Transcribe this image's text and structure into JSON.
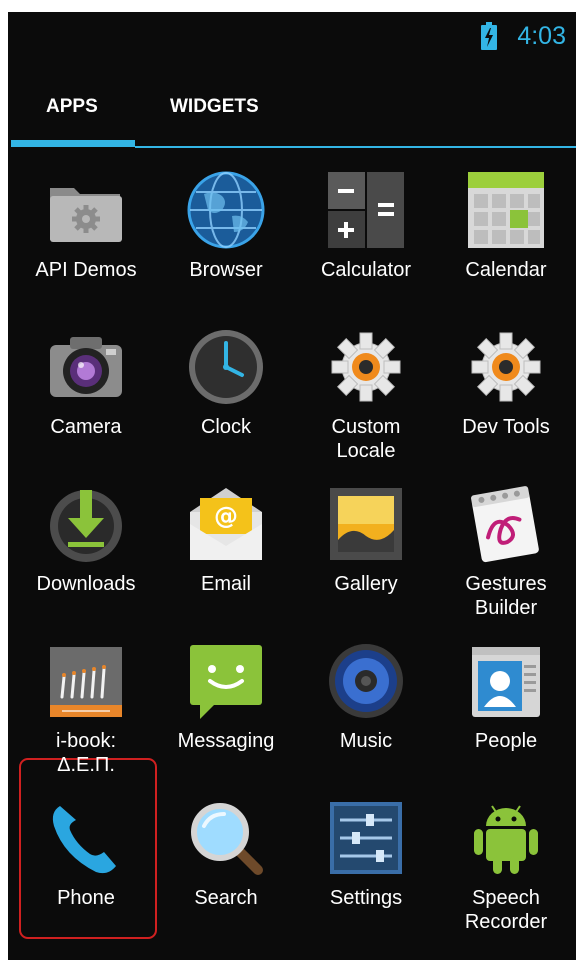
{
  "status_bar": {
    "time": "4:03",
    "battery_icon": "battery-charging-icon"
  },
  "tabs": [
    {
      "label": "APPS",
      "selected": true
    },
    {
      "label": "WIDGETS",
      "selected": false
    }
  ],
  "apps": [
    {
      "label": "API Demos",
      "icon": "folder-gear-icon"
    },
    {
      "label": "Browser",
      "icon": "globe-icon"
    },
    {
      "label": "Calculator",
      "icon": "calculator-icon"
    },
    {
      "label": "Calendar",
      "icon": "calendar-icon"
    },
    {
      "label": "Camera",
      "icon": "camera-icon"
    },
    {
      "label": "Clock",
      "icon": "clock-icon"
    },
    {
      "label": "Custom\nLocale",
      "icon": "gear-icon"
    },
    {
      "label": "Dev Tools",
      "icon": "gear-icon"
    },
    {
      "label": "Downloads",
      "icon": "download-icon"
    },
    {
      "label": "Email",
      "icon": "envelope-icon"
    },
    {
      "label": "Gallery",
      "icon": "picture-frame-icon"
    },
    {
      "label": "Gestures\nBuilder",
      "icon": "gesture-pad-icon"
    },
    {
      "label": "i-book:\nΔ.Ε.Π.",
      "icon": "ibook-icon",
      "highlighted": true
    },
    {
      "label": "Messaging",
      "icon": "speech-bubble-icon"
    },
    {
      "label": "Music",
      "icon": "speaker-icon"
    },
    {
      "label": "People",
      "icon": "contact-card-icon"
    },
    {
      "label": "Phone",
      "icon": "phone-handset-icon"
    },
    {
      "label": "Search",
      "icon": "magnifier-icon"
    },
    {
      "label": "Settings",
      "icon": "sliders-icon"
    },
    {
      "label": "Speech\nRecorder",
      "icon": "android-robot-icon"
    }
  ]
}
